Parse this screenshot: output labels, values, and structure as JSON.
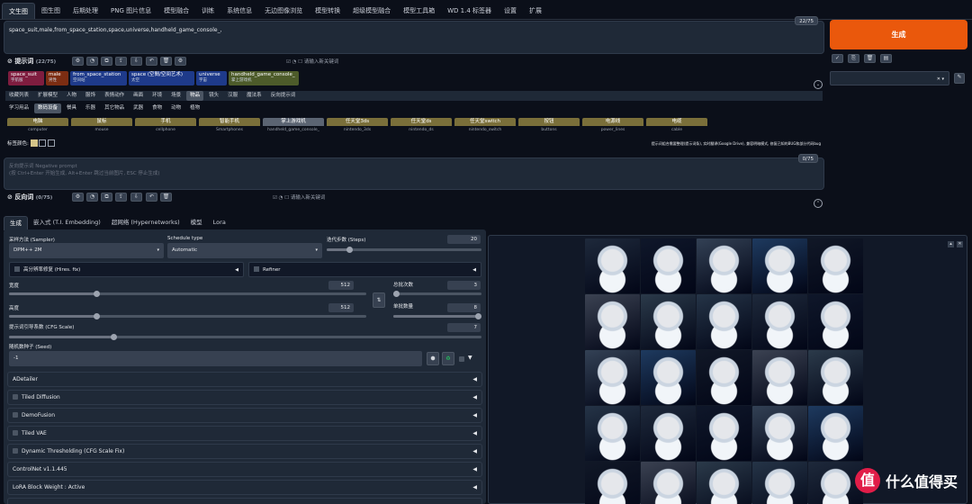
{
  "tabs": [
    "文生图",
    "图生图",
    "后期处理",
    "PNG 图片信息",
    "模型融合",
    "训练",
    "系统信息",
    "无边图像浏览",
    "模型转换",
    "超级模型融合",
    "模型工具箱",
    "WD 1.4 标签器",
    "设置",
    "扩展"
  ],
  "prompt": {
    "text": "space_suit,male,from_space_station,space,universe,handheld_game_console_,",
    "counter": "22/75"
  },
  "generate_label": "生成",
  "positive": {
    "title": "提示词",
    "count": "(22/75)",
    "new_keyword_placeholder": "请输入新关键词",
    "chips": [
      {
        "t": "space_suit",
        "s": "宇航服",
        "color": "#7f1d3f"
      },
      {
        "t": "male",
        "s": "男性",
        "color": "#7c2d12"
      },
      {
        "t": "from_space_station",
        "s": "空间站",
        "color": "#1e3a8a"
      },
      {
        "t": "space (空間/空间艺术)",
        "s": "太空",
        "color": "#1e3a8a"
      },
      {
        "t": "universe",
        "s": "宇宙",
        "color": "#1e3a8a"
      },
      {
        "t": "handheld_game_console_",
        "s": "掌上游戏机",
        "color": "#4d5b2a"
      }
    ],
    "categories": [
      "收藏列表",
      "扩展模型",
      "人物",
      "服饰",
      "表情动作",
      "画面",
      "环境",
      "场景",
      "物品",
      "镜头",
      "汉服",
      "魔法系",
      "反向提示词"
    ],
    "subcategories": [
      "学习用品",
      "数码设备",
      "餐具",
      "乐器",
      "其它物品",
      "武器",
      "食物",
      "动物",
      "植物"
    ],
    "keywords": [
      {
        "a": "电脑",
        "b": "computer"
      },
      {
        "a": "鼠标",
        "b": "mouse"
      },
      {
        "a": "手机",
        "b": "cellphone"
      },
      {
        "a": "智能手机",
        "b": "Smartphones"
      },
      {
        "a": "掌上游戏机",
        "b": "handheld_game_console_"
      },
      {
        "a": "任天堂3ds",
        "b": "nintendo_3ds"
      },
      {
        "a": "任天堂ds",
        "b": "nintendo_ds"
      },
      {
        "a": "任天堂switch",
        "b": "nintendo_switch"
      },
      {
        "a": "按钮",
        "b": "buttons"
      },
      {
        "a": "电源线",
        "b": "power_lines"
      },
      {
        "a": "电缆",
        "b": "cable"
      }
    ],
    "tag_color_label": "标签颜色:",
    "hint": "提示词组合需要整理(提示词条), 实时翻译(Google Drive), 兼容明暗模式, 修复已知的BUG和部分代码bug"
  },
  "negative": {
    "placeholder_line1": "反向提示词 Negative prompt",
    "placeholder_line2": "(按 Ctrl+Enter 开始生成, Alt+Enter 跳过当前图片, ESC 停止生成)",
    "counter": "0/75",
    "title": "反向词",
    "count": "(0/75)",
    "new_keyword_placeholder": "请输入新关键词"
  },
  "sub_tabs": [
    "生成",
    "嵌入式 (T.I. Embedding)",
    "超网络 (Hypernetworks)",
    "模型",
    "Lora"
  ],
  "settings": {
    "sampler_label": "采样方法 (Sampler)",
    "sampler_value": "DPM++ 2M",
    "schedule_label": "Schedule type",
    "schedule_value": "Automatic",
    "steps_label": "迭代步数 (Steps)",
    "steps_value": "20",
    "hires_label": "高分辨率修复 (Hires. fix)",
    "refiner_label": "Refiner",
    "width_label": "宽度",
    "width_value": "512",
    "height_label": "高度",
    "height_value": "512",
    "batch_count_label": "总批次数",
    "batch_count_value": "3",
    "batch_size_label": "单批数量",
    "batch_size_value": "8",
    "cfg_label": "提示词引导系数 (CFG Scale)",
    "cfg_value": "7",
    "seed_label": "随机数种子 (Seed)",
    "seed_value": "-1",
    "swap_icon": "⇅"
  },
  "accordions": [
    "ADetailer",
    "Tiled Diffusion",
    "DemoFusion",
    "Tiled VAE",
    "Dynamic Thresholding (CFG Scale Fix)",
    "ControlNet v1.1.445",
    "LoRA Block Weight : Active"
  ],
  "watermark": {
    "logo": "值",
    "text": "什么值得买"
  }
}
